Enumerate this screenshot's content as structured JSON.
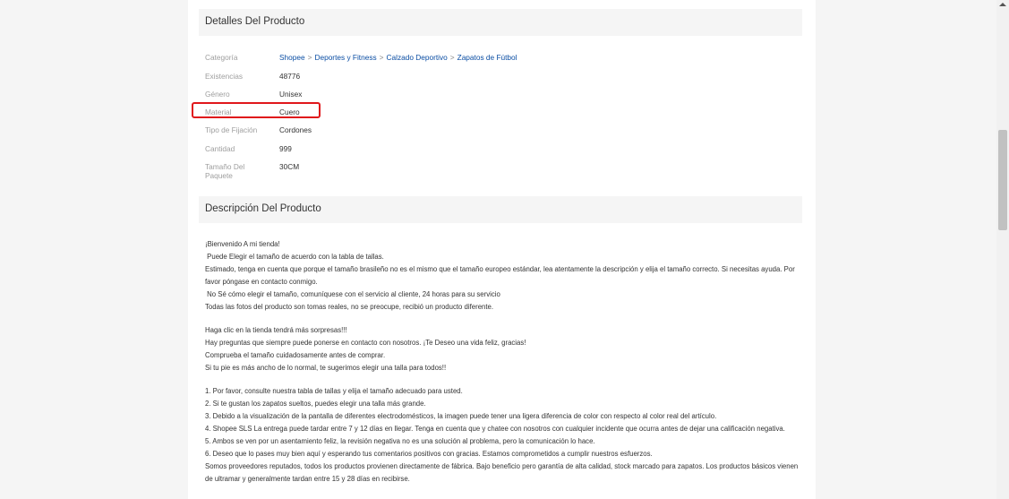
{
  "details": {
    "title": "Detalles Del Producto",
    "breadcrumb_label": "Categoría",
    "breadcrumb": [
      "Shopee",
      "Deportes y Fitness",
      "Calzado Deportivo",
      "Zapatos de Fútbol"
    ],
    "breadcrumb_sep": ">",
    "specs": [
      {
        "label": "Existencias",
        "value": "48776"
      },
      {
        "label": "Género",
        "value": "Unisex"
      },
      {
        "label": "Material",
        "value": "Cuero"
      },
      {
        "label": "Tipo de Fijación",
        "value": "Cordones"
      },
      {
        "label": "Cantidad",
        "value": "999"
      },
      {
        "label": "Tamaño Del Paquete",
        "value": "30CM"
      }
    ]
  },
  "description": {
    "title": "Descripción Del Producto",
    "lines": [
      "¡Bienvenido A mi tienda!",
      " Puede Elegir el tamaño de acuerdo con la tabla de tallas.",
      "Estimado, tenga en cuenta que porque el tamaño brasileño no es el mismo que el tamaño europeo estándar, lea atentamente la descripción y elija el tamaño correcto. Si necesitas ayuda. Por favor póngase en contacto conmigo.",
      " No Sé cómo elegir el tamaño, comuníquese con el servicio al cliente, 24 horas para su servicio",
      "Todas las fotos del producto son tomas reales, no se preocupe, recibió un producto diferente.",
      "",
      "Haga clic en la tienda tendrá más sorpresas!!!",
      "Hay preguntas que siempre puede ponerse en contacto con nosotros. ¡Te Deseo una vida feliz, gracias!",
      "Comprueba el tamaño cuidadosamente antes de comprar.",
      "Si tu pie es más ancho de lo normal, te sugerimos elegir una talla para todos!!",
      "",
      "1. Por favor, consulte nuestra tabla de tallas y elija el tamaño adecuado para usted.",
      "2. Si te gustan los zapatos sueltos, puedes elegir una talla más grande.",
      "3. Debido a la visualización de la pantalla de diferentes electrodomésticos, la imagen puede tener una ligera diferencia de color con respecto al color real del artículo.",
      "4. Shopee SLS La entrega puede tardar entre 7 y 12 días en llegar. Tenga en cuenta que y chatee con nosotros con cualquier incidente que ocurra antes de dejar una calificación negativa.",
      "5. Ambos se ven por un asentamiento feliz, la revisión negativa no es una solución al problema, pero la comunicación lo hace.",
      "6. Deseo que lo pases muy bien aquí y esperando tus comentarios positivos con gracias. Estamos comprometidos a cumplir nuestros esfuerzos.",
      "Somos proveedores reputados, todos los productos provienen directamente de fábrica. Bajo beneficio pero garantía de alta calidad, stock marcado para zapatos. Los productos básicos vienen de ultramar y generalmente tardan entre 15 y 28 días en recibirse."
    ]
  },
  "colors": {
    "highlight": "#e0171b",
    "link": "#0a4da3"
  }
}
